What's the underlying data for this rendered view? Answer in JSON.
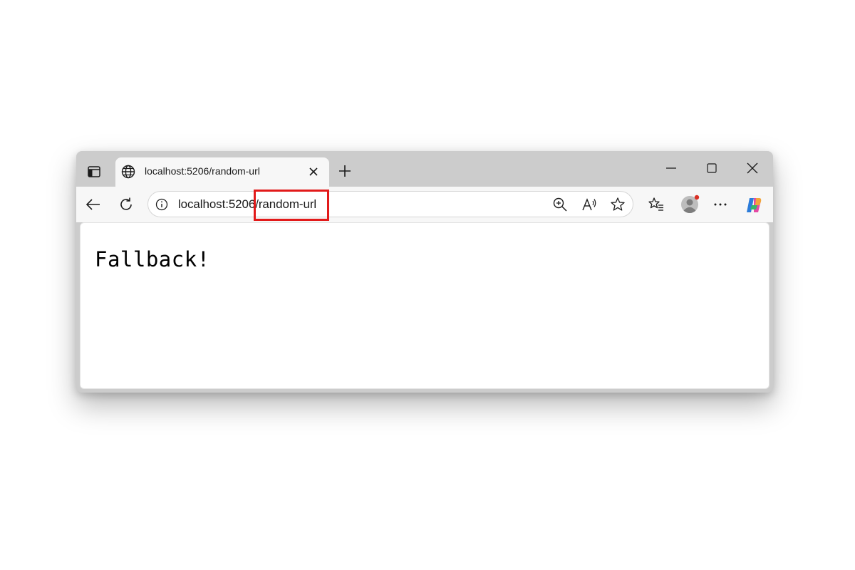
{
  "tab": {
    "title": "localhost:5206/random-url"
  },
  "addressbar": {
    "url": "localhost:5206/random-url"
  },
  "page": {
    "body_text": "Fallback!"
  },
  "icons": {
    "sidebar_toggle": "tab-actions-icon",
    "favicon": "globe-icon",
    "tab_close": "close-icon",
    "new_tab": "plus-icon",
    "minimize": "minimize-icon",
    "maximize": "maximize-icon",
    "close_window": "close-icon",
    "back": "arrow-left-icon",
    "reload": "refresh-icon",
    "site_info": "info-icon",
    "zoom": "zoom-in-icon",
    "read_aloud": "read-aloud-icon",
    "favorite": "star-icon",
    "favorites": "favorites-icon",
    "profile": "avatar-icon",
    "more": "more-icon",
    "copilot": "copilot-icon"
  },
  "colors": {
    "highlight_box": "#e21a1a",
    "profile_badge": "#d93025"
  }
}
